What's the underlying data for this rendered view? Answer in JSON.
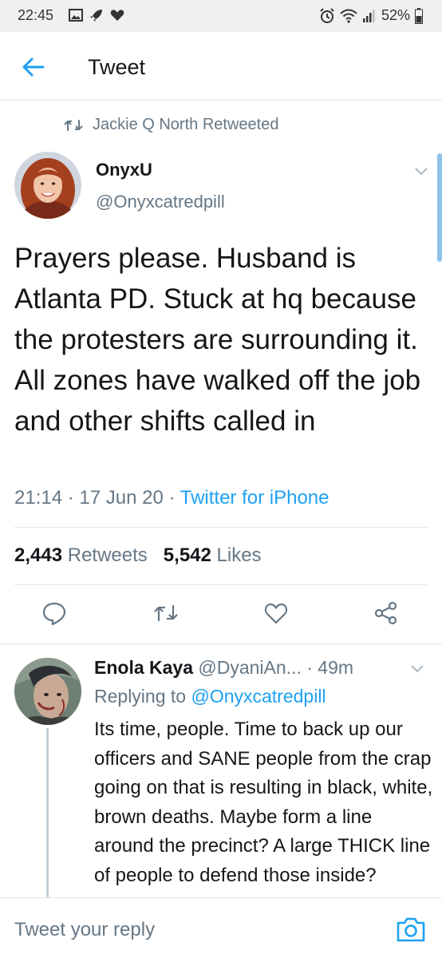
{
  "status_bar": {
    "time": "22:45",
    "battery": "52%",
    "left_icons": [
      "gallery-icon",
      "rocket-icon",
      "heart-icon"
    ],
    "right_icons": [
      "alarm-icon",
      "wifi-icon",
      "signal-icon",
      "battery-icon"
    ]
  },
  "header": {
    "title": "Tweet"
  },
  "retweet_context": {
    "text": "Jackie Q North Retweeted"
  },
  "tweet": {
    "author_name": "OnyxU",
    "author_handle": "@Onyxcatredpill",
    "text": "Prayers please. Husband is Atlanta PD. Stuck at hq because the protesters are surrounding it. All zones have walked off the job and other shifts called in",
    "time": "21:14",
    "date": "17 Jun 20",
    "separator": "·",
    "source": "Twitter for iPhone",
    "retweets_count": "2,443",
    "retweets_label": "Retweets",
    "likes_count": "5,542",
    "likes_label": "Likes"
  },
  "reply": {
    "name": "Enola Kaya",
    "handle": "@DyaniAn...",
    "age": "· 49m",
    "replying_prefix": "Replying to",
    "replying_to": "@Onyxcatredpill",
    "text": "Its time, people. Time to back up our officers and SANE people from the crap going on that is resulting in black, white, brown deaths.  Maybe form a line around the precinct? A large THICK line of people to defend those inside?"
  },
  "compose": {
    "placeholder": "Tweet your reply"
  },
  "colors": {
    "accent": "#1da1f2",
    "muted": "#657786",
    "text": "#14171a",
    "divider": "#e1e8ed"
  }
}
